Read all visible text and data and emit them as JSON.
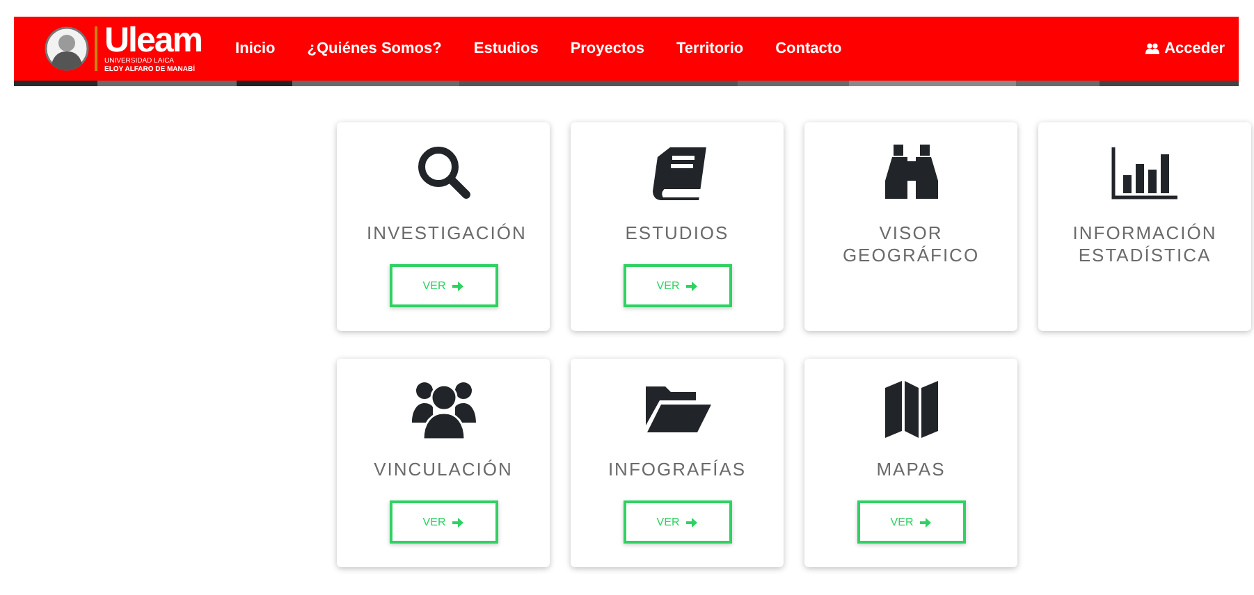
{
  "navbar": {
    "logo": {
      "wordmark": "Uleam",
      "line_1": "UNIVERSIDAD LAICA",
      "line_2": "ELOY ALFARO DE MANABÍ"
    },
    "links": [
      "Inicio",
      "¿Quiénes Somos?",
      "Estudios",
      "Proyectos",
      "Territorio",
      "Contacto"
    ],
    "login": "Acceder"
  },
  "cards": [
    {
      "kind": "search",
      "title": "INVESTIGACIÓN",
      "button": "VER"
    },
    {
      "kind": "book",
      "title": "ESTUDIOS",
      "button": "VER"
    },
    {
      "kind": "binoculars",
      "title": "VISOR GEOGRÁFICO"
    },
    {
      "kind": "chart",
      "title": "INFORMACIÓN ESTADÍSTICA"
    },
    {
      "kind": "users",
      "title": "VINCULACIÓN",
      "button": "VER"
    },
    {
      "kind": "folder",
      "title": "INFOGRAFÍAS",
      "button": "VER"
    },
    {
      "kind": "map",
      "title": "MAPAS",
      "button": "VER"
    }
  ]
}
